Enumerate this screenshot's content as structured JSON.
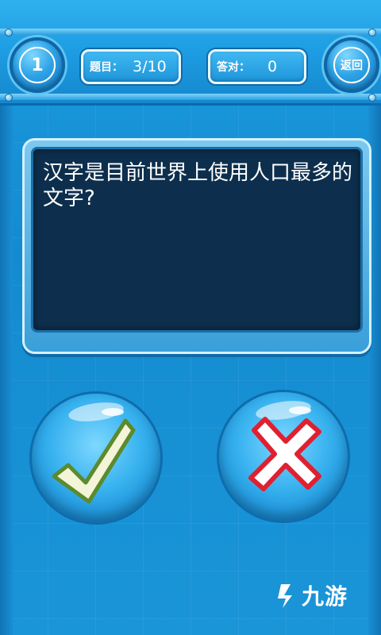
{
  "header": {
    "level": "1",
    "question_label": "题目：",
    "question_progress": "3/10",
    "correct_label": "答对：",
    "correct_count": "0",
    "back_label": "返回"
  },
  "question": {
    "text": "汉字是目前世界上使用人口最多的文字?"
  },
  "answers": {
    "true_icon": "check-icon",
    "false_icon": "cross-icon"
  },
  "watermark": {
    "text": "九游"
  },
  "colors": {
    "background": "#1792d6",
    "panel": "#0d2f4d",
    "check_fill": "#f4f4d8",
    "check_outline": "#5c8a2c",
    "cross_fill": "#ffffff",
    "cross_outline": "#e02030"
  }
}
